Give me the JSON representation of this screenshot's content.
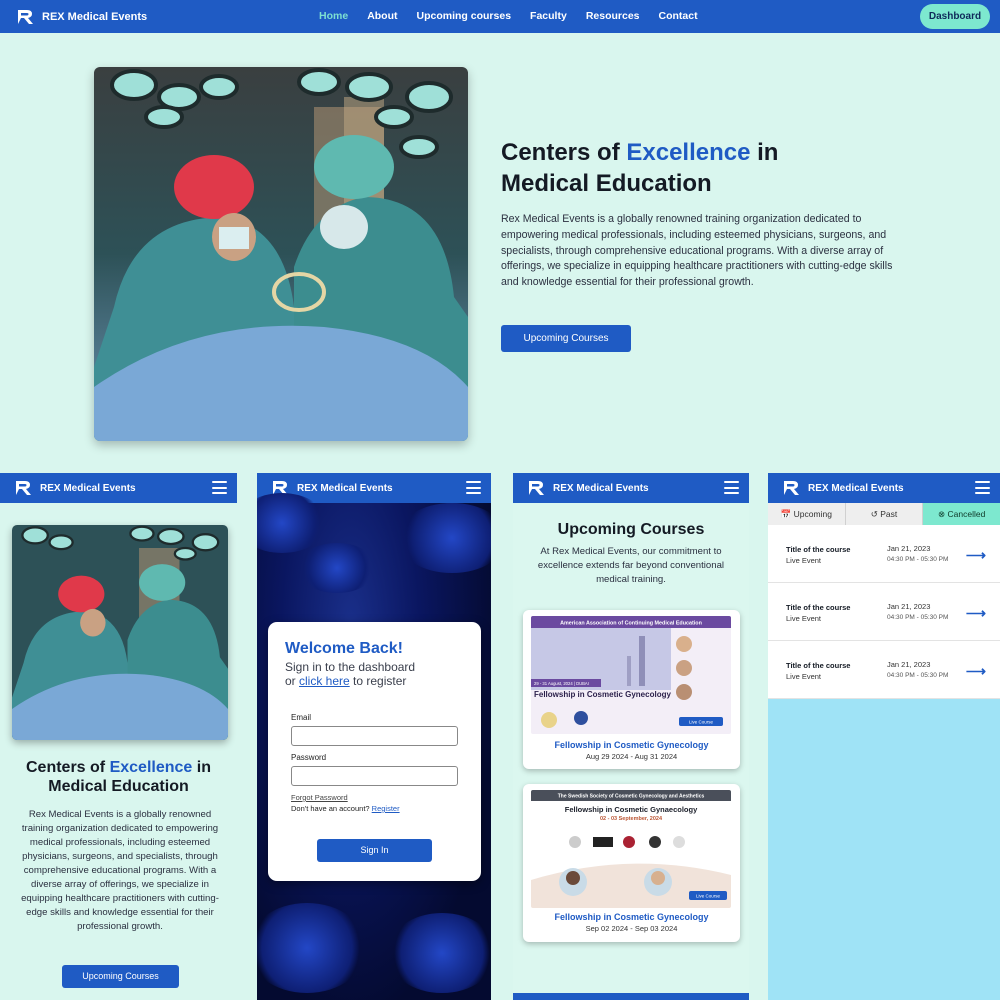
{
  "brand": {
    "name": "REX Medical Events"
  },
  "nav": {
    "links": [
      "Home",
      "About",
      "Upcoming courses",
      "Faculty",
      "Resources",
      "Contact"
    ],
    "active": "Home",
    "dashboard_label": "Dashboard"
  },
  "hero": {
    "title_prefix": "Centers of ",
    "title_accent": "Excellence",
    "title_suffix_1": " in",
    "title_suffix_2": "Medical Education",
    "text": "Rex Medical Events is a globally renowned training organization dedicated to empowering medical professionals, including esteemed physicians, surgeons, and specialists, through comprehensive educational programs. With a diverse array of offerings, we specialize in equipping healthcare practitioners with cutting-edge skills and knowledge essential for their professional growth.",
    "button_label": "Upcoming Courses"
  },
  "login": {
    "title": "Welcome Back!",
    "subtitle_line1": "Sign in to the dashboard",
    "subtitle_or": "or ",
    "subtitle_link": "click here",
    "subtitle_end": " to register",
    "email_label": "Email",
    "password_label": "Password",
    "forgot_label": "Forgot Password",
    "no_account": "Don't have an account? ",
    "register_label": "Register",
    "signin_label": "Sign In"
  },
  "upcoming": {
    "title": "Upcoming Courses",
    "text": "At Rex Medical Events, our commitment to excellence extends far beyond conventional medical training.",
    "courses": [
      {
        "name": "Fellowship in Cosmetic Gynecology",
        "dates": "Aug 29 2024 - Aug 31 2024",
        "poster_header": "American Association of Continuing Medical Education",
        "poster_date": "29 - 31 August, 2024 | DUBAI",
        "poster_title": "Fellowship in Cosmetic Gynecology",
        "poster_badge": "Live Course"
      },
      {
        "name": "Fellowship in Cosmetic Gynecology",
        "dates": "Sep 02 2024 - Sep 03 2024",
        "poster_header": "The Swedish Society of Cosmetic Gynecology and Aesthetics",
        "poster_title": "Fellowship in Cosmetic Gynaecology",
        "poster_date": "02 - 03 September, 2024",
        "poster_badge": "Live Course"
      }
    ]
  },
  "events": {
    "tabs": [
      "Upcoming",
      "Past",
      "Cancelled"
    ],
    "selected_tab": "Cancelled",
    "items": [
      {
        "title": "Title of the course",
        "type": "Live Event",
        "date": "Jan 21, 2023",
        "time": "04:30 PM - 05:30 PM"
      },
      {
        "title": "Title of the course",
        "type": "Live Event",
        "date": "Jan 21, 2023",
        "time": "04:30 PM - 05:30 PM"
      },
      {
        "title": "Title of the course",
        "type": "Live Event",
        "date": "Jan 21, 2023",
        "time": "04:30 PM - 05:30 PM"
      }
    ]
  },
  "colors": {
    "primary": "#1f5bc4",
    "accent_mint": "#7de8cf",
    "background": "#d9f6ee"
  }
}
